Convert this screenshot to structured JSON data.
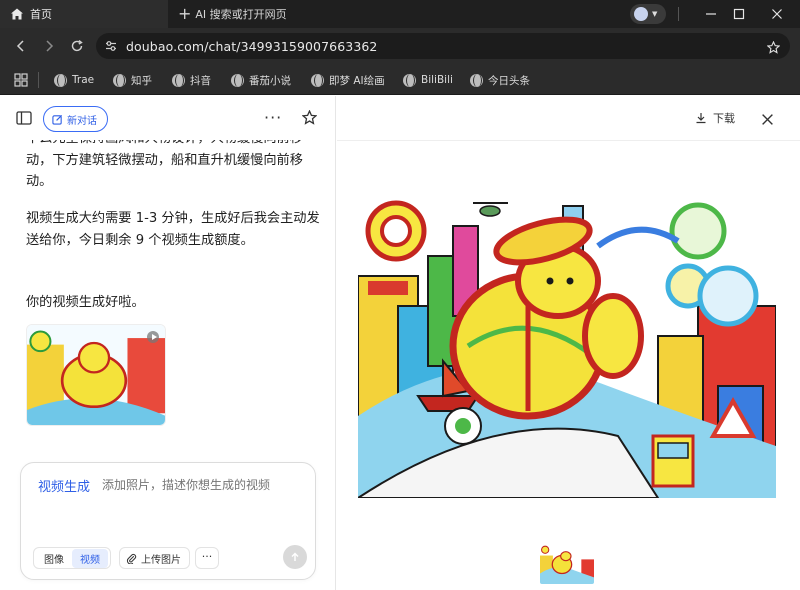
{
  "browser": {
    "home_tab_label": "首页",
    "new_tab_label": "AI 搜索或打开网页",
    "url": "doubao.com/chat/34993159007663362",
    "bookmarks": [
      "Trae",
      "知乎",
      "抖音",
      "番茄小说",
      "即梦 AI绘画",
      "BiliBili",
      "今日头条"
    ]
  },
  "header": {
    "new_chat_label": "新对话",
    "more_label": "···"
  },
  "chat": {
    "messages": [
      "中么元全保持画风和人物设计，人物缓慢向前移动，下方建筑轻微摆动，船和直升机缓慢向前移动。",
      "视频生成大约需要 1-3 分钟，生成好后我会主动发送给你，今日剩余 9 个视频生成额度。",
      "你的视频生成好啦。"
    ]
  },
  "composer": {
    "mode_label": "视频生成",
    "placeholder": "添加照片，描述你想生成的视频",
    "seg_image": "图像",
    "seg_video": "视频",
    "upload_label": "上传图片",
    "more_label": "···"
  },
  "preview": {
    "download_label": "下载"
  },
  "colors": {
    "accent": "#2f5fe6",
    "chrome_dark": "#2b2b2b"
  }
}
